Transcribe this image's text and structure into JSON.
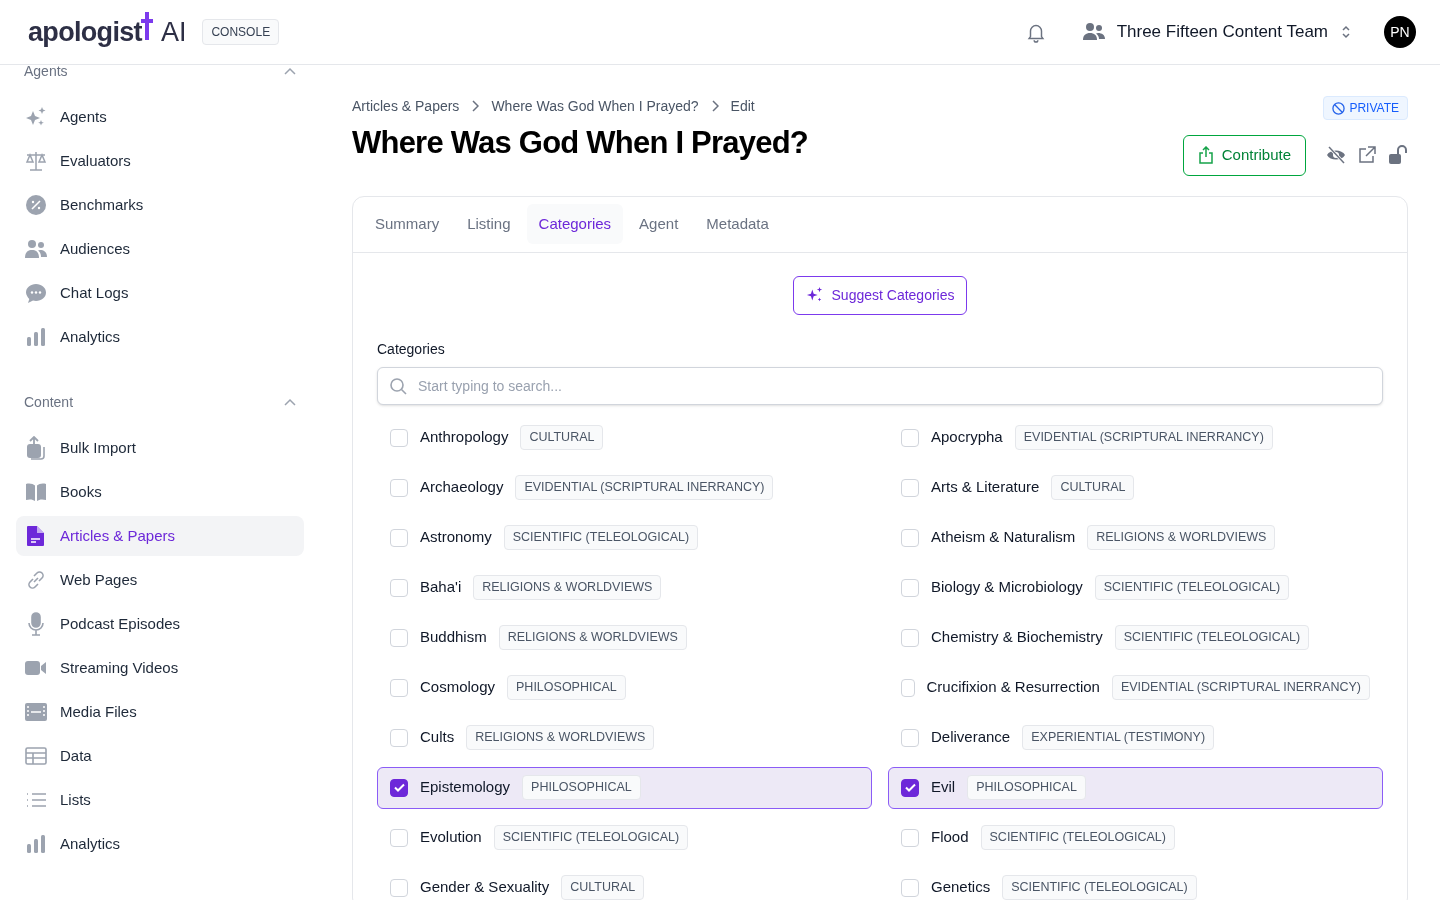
{
  "header": {
    "logo": "apologist",
    "logo_suffix": "AI",
    "console_badge": "CONSOLE",
    "team": "Three Fifteen Content Team",
    "avatar": "PN"
  },
  "sidebar": {
    "sections": [
      {
        "title": "Agents",
        "expanded": true,
        "items": [
          {
            "label": "Agents",
            "selected": false
          },
          {
            "label": "Evaluators",
            "selected": false
          },
          {
            "label": "Benchmarks",
            "selected": false
          },
          {
            "label": "Audiences",
            "selected": false
          },
          {
            "label": "Chat Logs",
            "selected": false
          },
          {
            "label": "Analytics",
            "selected": false
          }
        ]
      },
      {
        "title": "Content",
        "expanded": true,
        "items": [
          {
            "label": "Bulk Import",
            "selected": false
          },
          {
            "label": "Books",
            "selected": false
          },
          {
            "label": "Articles & Papers",
            "selected": true
          },
          {
            "label": "Web Pages",
            "selected": false
          },
          {
            "label": "Podcast Episodes",
            "selected": false
          },
          {
            "label": "Streaming Videos",
            "selected": false
          },
          {
            "label": "Media Files",
            "selected": false
          },
          {
            "label": "Data",
            "selected": false
          },
          {
            "label": "Lists",
            "selected": false
          },
          {
            "label": "Analytics",
            "selected": false
          }
        ]
      }
    ]
  },
  "breadcrumbs": [
    "Articles & Papers",
    "Where Was God When I Prayed?",
    "Edit"
  ],
  "visibility_badge": "PRIVATE",
  "title": "Where Was God When I Prayed?",
  "contribute_button": "Contribute",
  "tabs": [
    {
      "label": "Summary",
      "selected": false
    },
    {
      "label": "Listing",
      "selected": false
    },
    {
      "label": "Categories",
      "selected": true
    },
    {
      "label": "Agent",
      "selected": false
    },
    {
      "label": "Metadata",
      "selected": false
    }
  ],
  "suggest_button": "Suggest Categories",
  "categories_label": "Categories",
  "search": {
    "placeholder": "Start typing to search..."
  },
  "categories": [
    {
      "name": "Anthropology",
      "tag": "CULTURAL",
      "checked": false
    },
    {
      "name": "Apocrypha",
      "tag": "EVIDENTIAL (SCRIPTURAL INERRANCY)",
      "checked": false
    },
    {
      "name": "Archaeology",
      "tag": "EVIDENTIAL (SCRIPTURAL INERRANCY)",
      "checked": false
    },
    {
      "name": "Arts & Literature",
      "tag": "CULTURAL",
      "checked": false
    },
    {
      "name": "Astronomy",
      "tag": "SCIENTIFIC (TELEOLOGICAL)",
      "checked": false
    },
    {
      "name": "Atheism & Naturalism",
      "tag": "RELIGIONS & WORLDVIEWS",
      "checked": false
    },
    {
      "name": "Baha'i",
      "tag": "RELIGIONS & WORLDVIEWS",
      "checked": false
    },
    {
      "name": "Biology & Microbiology",
      "tag": "SCIENTIFIC (TELEOLOGICAL)",
      "checked": false
    },
    {
      "name": "Buddhism",
      "tag": "RELIGIONS & WORLDVIEWS",
      "checked": false
    },
    {
      "name": "Chemistry & Biochemistry",
      "tag": "SCIENTIFIC (TELEOLOGICAL)",
      "checked": false
    },
    {
      "name": "Cosmology",
      "tag": "PHILOSOPHICAL",
      "checked": false
    },
    {
      "name": "Crucifixion & Resurrection",
      "tag": "EVIDENTIAL (SCRIPTURAL INERRANCY)",
      "checked": false
    },
    {
      "name": "Cults",
      "tag": "RELIGIONS & WORLDVIEWS",
      "checked": false
    },
    {
      "name": "Deliverance",
      "tag": "EXPERIENTIAL (TESTIMONY)",
      "checked": false
    },
    {
      "name": "Epistemology",
      "tag": "PHILOSOPHICAL",
      "checked": true
    },
    {
      "name": "Evil",
      "tag": "PHILOSOPHICAL",
      "checked": true
    },
    {
      "name": "Evolution",
      "tag": "SCIENTIFIC (TELEOLOGICAL)",
      "checked": false
    },
    {
      "name": "Flood",
      "tag": "SCIENTIFIC (TELEOLOGICAL)",
      "checked": false
    },
    {
      "name": "Gender & Sexuality",
      "tag": "CULTURAL",
      "checked": false
    },
    {
      "name": "Genetics",
      "tag": "SCIENTIFIC (TELEOLOGICAL)",
      "checked": false
    }
  ]
}
